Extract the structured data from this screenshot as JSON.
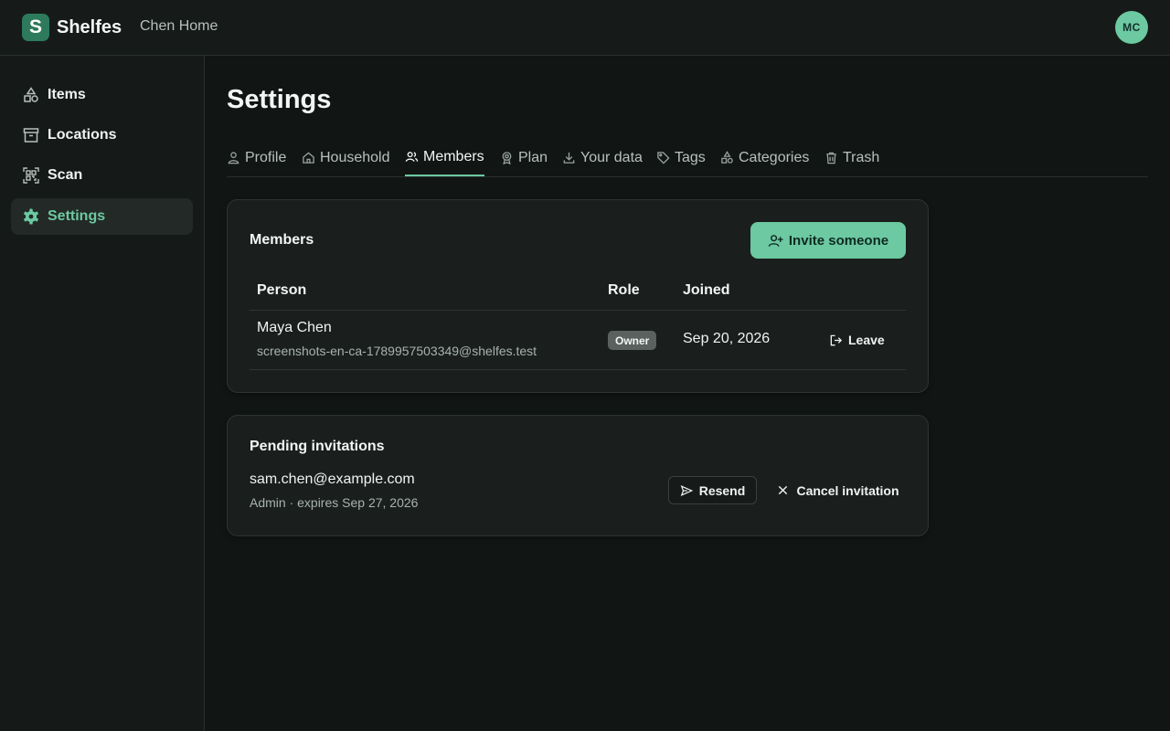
{
  "app": {
    "logo_letter": "S",
    "name": "Shelfes",
    "household": "Chen Home",
    "user_initials": "MC"
  },
  "sidebar": {
    "items": [
      {
        "label": "Items",
        "icon": "shapes-icon",
        "active": false
      },
      {
        "label": "Locations",
        "icon": "archive-box-icon",
        "active": false
      },
      {
        "label": "Scan",
        "icon": "qr-scan-icon",
        "active": false
      },
      {
        "label": "Settings",
        "icon": "gear-icon",
        "active": true
      }
    ]
  },
  "page": {
    "title": "Settings"
  },
  "tabs": [
    {
      "label": "Profile",
      "icon": "user-icon",
      "active": false
    },
    {
      "label": "Household",
      "icon": "home-icon",
      "active": false
    },
    {
      "label": "Members",
      "icon": "users-icon",
      "active": true
    },
    {
      "label": "Plan",
      "icon": "award-icon",
      "active": false
    },
    {
      "label": "Your data",
      "icon": "download-icon",
      "active": false
    },
    {
      "label": "Tags",
      "icon": "tag-icon",
      "active": false
    },
    {
      "label": "Categories",
      "icon": "shapes-icon",
      "active": false
    },
    {
      "label": "Trash",
      "icon": "trash-icon",
      "active": false
    }
  ],
  "members": {
    "title": "Members",
    "invite_label": "Invite someone",
    "columns": [
      "Person",
      "Role",
      "Joined"
    ],
    "rows": [
      {
        "name": "Maya Chen",
        "email": "screenshots-en-ca-1789957503349@shelfes.test",
        "role": "Owner",
        "joined": "Sep 20, 2026",
        "action": "Leave"
      }
    ]
  },
  "pending": {
    "title": "Pending invitations",
    "invitations": [
      {
        "email": "sam.chen@example.com",
        "meta": "Admin · expires Sep 27, 2026",
        "resend_label": "Resend",
        "cancel_label": "Cancel invitation"
      }
    ]
  },
  "colors": {
    "accent": "#6cc9a1",
    "background": "#111614",
    "card": "#1a1f1d",
    "logo": "#2d7a5c"
  }
}
